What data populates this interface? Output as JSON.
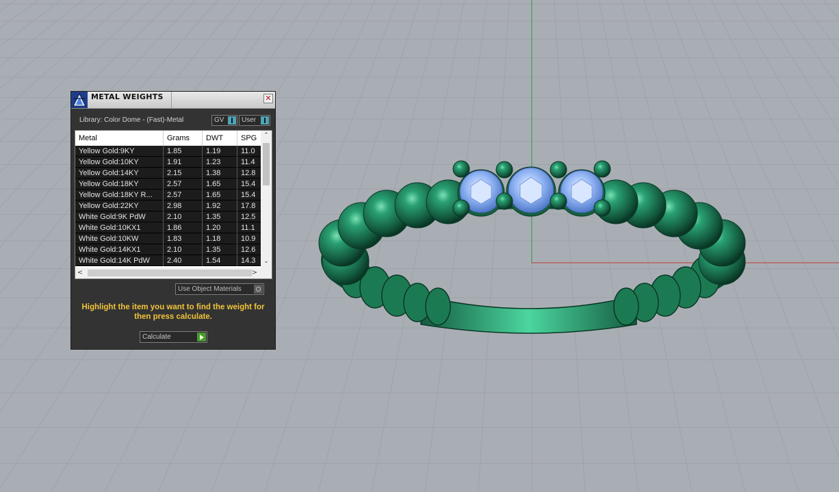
{
  "panel": {
    "title": "METAL WEIGHTS",
    "close_glyph": "✕",
    "library_label": "Library: Color Dome - (Fast)-Metal",
    "toggle_gv": "GV",
    "toggle_user": "User",
    "use_object_materials": "Use Object Materials",
    "hint": "Highlight the item you want to find the weight for then press calculate.",
    "calculate_label": "Calculate",
    "scroll_left": "<",
    "scroll_right": ">",
    "scroll_up": "⌃",
    "scroll_down": "⌄"
  },
  "table": {
    "headers": [
      "Metal",
      "Grams",
      "DWT",
      "SPG"
    ],
    "rows": [
      [
        "Yellow Gold:9KY",
        "1.85",
        "1.19",
        "11.0"
      ],
      [
        "Yellow Gold:10KY",
        "1.91",
        "1.23",
        "11.4"
      ],
      [
        "Yellow Gold:14KY",
        "2.15",
        "1.38",
        "12.8"
      ],
      [
        "Yellow Gold:18KY",
        "2.57",
        "1.65",
        "15.4"
      ],
      [
        "Yellow Gold:18KY R...",
        "2.57",
        "1.65",
        "15.4"
      ],
      [
        "Yellow Gold:22KY",
        "2.98",
        "1.92",
        "17.8"
      ],
      [
        "White Gold:9K PdW",
        "2.10",
        "1.35",
        "12.5"
      ],
      [
        "White Gold:10KX1",
        "1.86",
        "1.20",
        "11.1"
      ],
      [
        "White Gold:10KW",
        "1.83",
        "1.18",
        "10.9"
      ],
      [
        "White Gold:14KX1",
        "2.10",
        "1.35",
        "12.6"
      ],
      [
        "White Gold:14K PdW",
        "2.40",
        "1.54",
        "14.3"
      ]
    ]
  },
  "colors": {
    "viewport_bg": "#a9aeb4",
    "grid_line": "#9ea3a9",
    "axis_green": "#2a9a3a",
    "axis_red": "#c03a3a",
    "ring_metal": "#1f7a55",
    "gem": "#8fb3f2",
    "panel_bg": "#333333",
    "hint_text": "#f2c43a"
  },
  "icons": [
    "metal-weights-app-icon",
    "close-icon",
    "radio-icon",
    "play-arrow-icon"
  ]
}
